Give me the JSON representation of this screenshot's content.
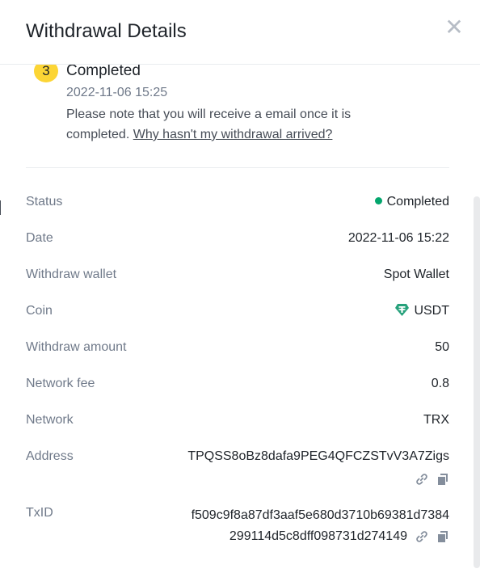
{
  "dialog": {
    "title": "Withdrawal Details",
    "close_icon": "close-icon"
  },
  "step": {
    "number": "3",
    "title": "Completed",
    "time": "2022-11-06 15:25",
    "note": "Please note that you will receive a email once it is completed.",
    "link": "Why hasn't my withdrawal arrived?"
  },
  "details": {
    "status_label": "Status",
    "status_value": "Completed",
    "status_color": "#03a66d",
    "date_label": "Date",
    "date_value": "2022-11-06 15:22",
    "wallet_label": "Withdraw wallet",
    "wallet_value": "Spot Wallet",
    "coin_label": "Coin",
    "coin_value": "USDT",
    "coin_icon": "tether-icon",
    "coin_color": "#26a17b",
    "amount_label": "Withdraw amount",
    "amount_value": "50",
    "fee_label": "Network fee",
    "fee_value": "0.8",
    "network_label": "Network",
    "network_value": "TRX",
    "address_label": "Address",
    "address_value": "TPQSS8oBz8dafa9PEG4QFCZSTvV3A7Zigs",
    "txid_label": "TxID",
    "txid_line1": "f509c9f8a87df3aaf5e680d3710b69381d7384",
    "txid_line2": "299114d5c8dff098731d274149"
  },
  "accent": "#fcd535"
}
